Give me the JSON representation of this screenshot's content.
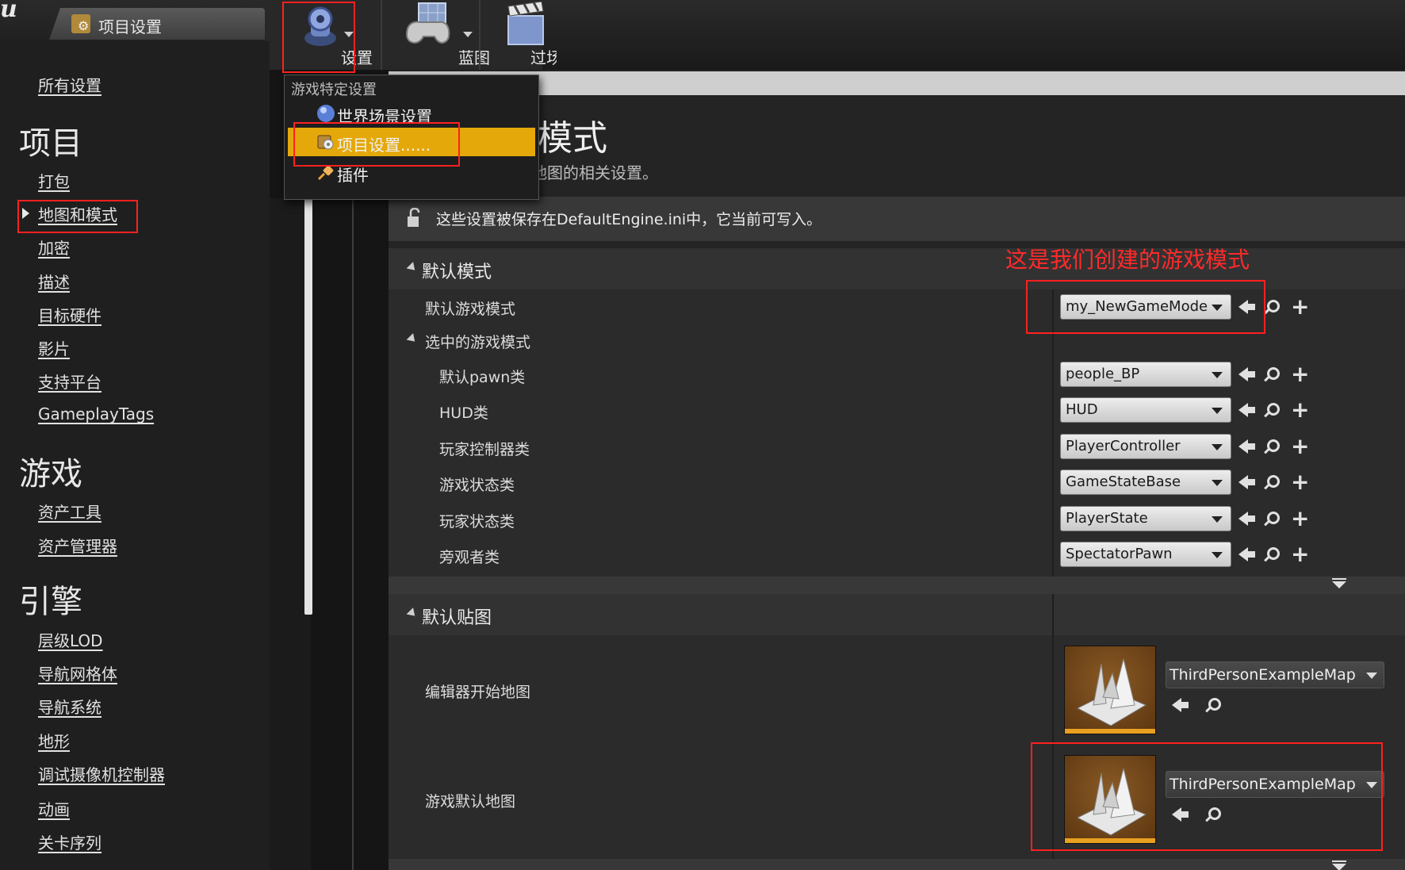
{
  "window": {
    "tab_title": "项目设置"
  },
  "toolbar": {
    "settings_label": "设置",
    "blueprint_label": "蓝图",
    "cinematics_label": "过场动"
  },
  "dropdown": {
    "header": "游戏特定设置",
    "items": [
      {
        "label": "世界场景设置",
        "icon": "globe-icon"
      },
      {
        "label": "项目设置......",
        "icon": "project-settings-icon",
        "active": true
      },
      {
        "label": "插件",
        "icon": "plugin-icon"
      }
    ]
  },
  "nav": {
    "all_settings": "所有设置",
    "sections": [
      {
        "title": "项目",
        "items": [
          "打包",
          "地图和模式",
          "加密",
          "描述",
          "目标硬件",
          "影片",
          "支持平台",
          "GameplayTags"
        ]
      },
      {
        "title": "游戏",
        "items": [
          "资产工具",
          "资产管理器"
        ]
      },
      {
        "title": "引擎",
        "items": [
          "层级LOD",
          "导航网格体",
          "导航系统",
          "地形",
          "调试摄像机控制器",
          "动画",
          "关卡序列"
        ]
      }
    ]
  },
  "main": {
    "title": "图和模式",
    "description": "式和其他地图的相关设置。",
    "notice": "这些设置被保存在DefaultEngine.ini中，它当前可写入。",
    "default_modes": {
      "header": "默认模式",
      "default_game_mode_label": "默认游戏模式",
      "default_game_mode_value": "my_NewGameMode",
      "selected_game_mode_label": "选中的游戏模式",
      "rows": [
        {
          "label": "默认pawn类",
          "value": "people_BP"
        },
        {
          "label": "HUD类",
          "value": "HUD"
        },
        {
          "label": "玩家控制器类",
          "value": "PlayerController"
        },
        {
          "label": "游戏状态类",
          "value": "GameStateBase"
        },
        {
          "label": "玩家状态类",
          "value": "PlayerState"
        },
        {
          "label": "旁观者类",
          "value": "SpectatorPawn"
        }
      ]
    },
    "default_maps": {
      "header": "默认贴图",
      "rows": [
        {
          "label": "编辑器开始地图",
          "value": "ThirdPersonExampleMap"
        },
        {
          "label": "游戏默认地图",
          "value": "ThirdPersonExampleMap"
        }
      ]
    }
  },
  "annotation": {
    "text": "这是我们创建的游戏模式",
    "color": "#ff2020"
  },
  "colors": {
    "menu_highlight": "#e4a80a",
    "thumb_accent": "#e8a020"
  }
}
